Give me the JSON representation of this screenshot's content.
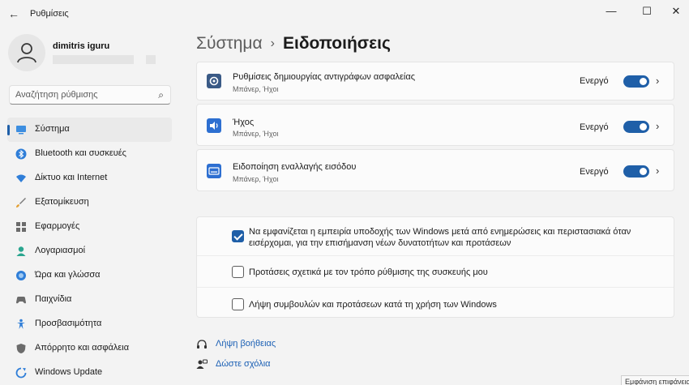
{
  "window": {
    "title": "Ρυθμίσεις",
    "back_icon": "arrow-left-icon",
    "minimize": "—",
    "maximize": "☐",
    "close": "✕"
  },
  "profile": {
    "name": "dimitris iguru"
  },
  "search": {
    "placeholder": "Αναζήτηση ρύθμισης",
    "icon": "⌕"
  },
  "sidebar": {
    "items": [
      {
        "label": "Σύστημα",
        "icon": "system-icon",
        "active": true
      },
      {
        "label": "Bluetooth και συσκευές",
        "icon": "bluetooth-icon"
      },
      {
        "label": "Δίκτυο και Internet",
        "icon": "wifi-icon"
      },
      {
        "label": "Εξατομίκευση",
        "icon": "brush-icon"
      },
      {
        "label": "Εφαρμογές",
        "icon": "apps-icon"
      },
      {
        "label": "Λογαριασμοί",
        "icon": "account-icon"
      },
      {
        "label": "Ώρα και γλώσσα",
        "icon": "globe-clock-icon"
      },
      {
        "label": "Παιχνίδια",
        "icon": "gamepad-icon"
      },
      {
        "label": "Προσβασιμότητα",
        "icon": "accessibility-icon"
      },
      {
        "label": "Απόρρητο και ασφάλεια",
        "icon": "shield-icon"
      },
      {
        "label": "Windows Update",
        "icon": "update-icon"
      }
    ]
  },
  "header": {
    "parent": "Σύστημα",
    "separator": "›",
    "current": "Ειδοποιήσεις"
  },
  "notification_apps": [
    {
      "title": "Ρυθμίσεις δημιουργίας αντιγράφων ασφαλείας",
      "subtitle": "Μπάνερ, Ήχοι",
      "state": "Ενεργό",
      "icon": "backup-icon",
      "on": true
    },
    {
      "title": "Ήχος",
      "subtitle": "Μπάνερ, Ήχοι",
      "state": "Ενεργό",
      "icon": "speaker-icon",
      "on": true
    },
    {
      "title": "Ειδοποίηση εναλλαγής εισόδου",
      "subtitle": "Μπάνερ, Ήχοι",
      "state": "Ενεργό",
      "icon": "keyboard-icon",
      "on": true
    }
  ],
  "checkboxes": [
    {
      "label": "Να εμφανίζεται η εμπειρία υποδοχής των Windows μετά από ενημερώσεις και περιστασιακά όταν εισέρχομαι, για την επισήμανση νέων δυνατοτήτων και προτάσεων",
      "checked": true
    },
    {
      "label": "Προτάσεις σχετικά με τον τρόπο ρύθμισης της συσκευής μου",
      "checked": false
    },
    {
      "label": "Λήψη συμβουλών και προτάσεων κατά τη χρήση των Windows",
      "checked": false
    }
  ],
  "links": [
    {
      "label": "Λήψη βοήθειας",
      "icon": "help-icon"
    },
    {
      "label": "Δώστε σχόλια",
      "icon": "feedback-icon"
    }
  ],
  "tooltip": "Εμφάνιση επιφάνειας",
  "colors": {
    "accent": "#1f5fa8",
    "link": "#1a5fb4",
    "card_icon": "#2d6fd1"
  }
}
